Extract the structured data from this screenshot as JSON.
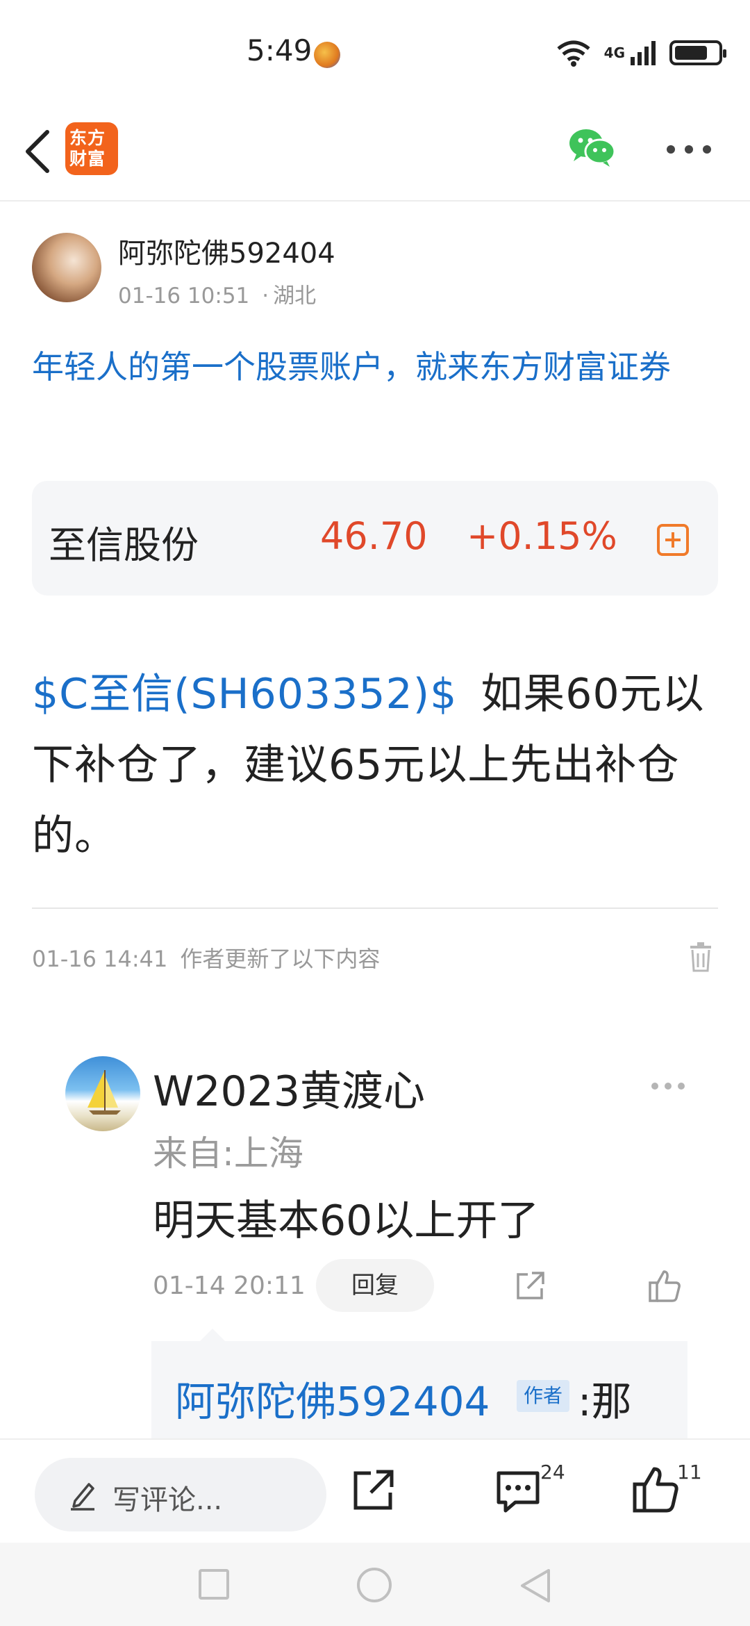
{
  "status_bar": {
    "time": "5:49",
    "network_label": "4G"
  },
  "header": {
    "logo_line1": "东方",
    "logo_line2": "财富"
  },
  "post": {
    "author_name": "阿弥陀佛592404",
    "timestamp": "01-16 10:51",
    "location": "湖北",
    "promo_text": "年轻人的第一个股票账户，就来东方财富证券",
    "stock": {
      "name": "至信股份",
      "price": "46.70",
      "change": "+0.15%",
      "change_color": "#e0482a"
    },
    "stock_tag": "$C至信(SH603352)$",
    "body_text": "如果60元以下补仓了，建议65元以上先出补仓的。"
  },
  "update": {
    "timestamp": "01-16 14:41",
    "text": "作者更新了以下内容"
  },
  "comment": {
    "author": "W2023黄渡心",
    "location": "来自:上海",
    "text": "明天基本60以上开了",
    "timestamp": "01-14 20:11",
    "reply_label": "回复",
    "nested_reply": {
      "author": "阿弥陀佛592404",
      "badge": "作者",
      "text": ":那"
    }
  },
  "bottom_bar": {
    "comment_placeholder": "写评论...",
    "comments_count": "24",
    "likes_count": "11"
  },
  "colors": {
    "accent_blue": "#1a6fc9",
    "stock_red": "#e0482a",
    "brand_orange": "#f2631c",
    "wechat_green": "#3fc35a"
  }
}
